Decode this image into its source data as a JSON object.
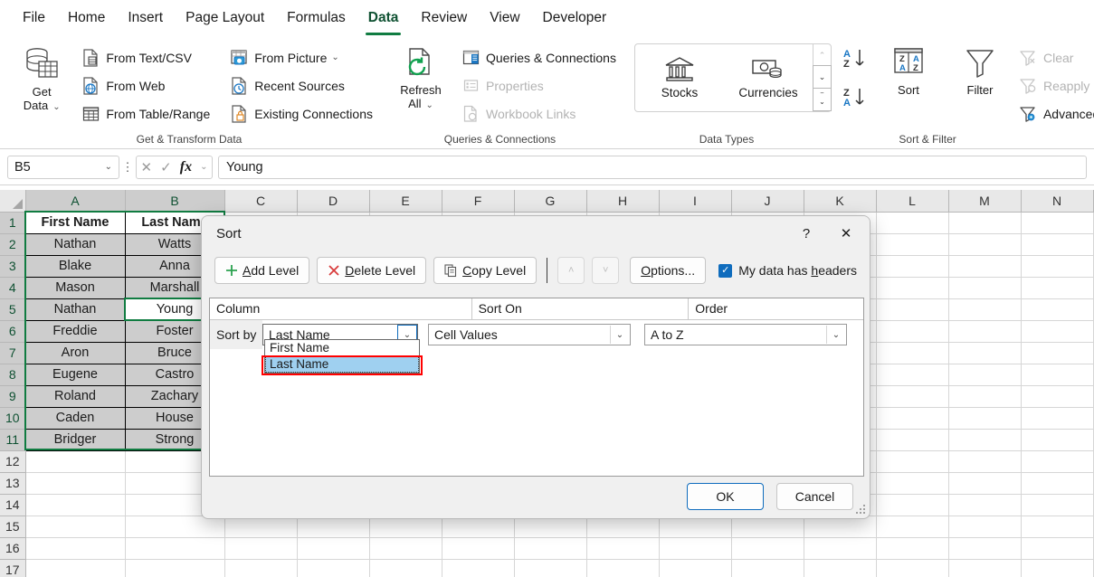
{
  "ribbon": {
    "tabs": [
      {
        "label": "File",
        "active": false
      },
      {
        "label": "Home",
        "active": false
      },
      {
        "label": "Insert",
        "active": false
      },
      {
        "label": "Page Layout",
        "active": false
      },
      {
        "label": "Formulas",
        "active": false
      },
      {
        "label": "Data",
        "active": true
      },
      {
        "label": "Review",
        "active": false
      },
      {
        "label": "View",
        "active": false
      },
      {
        "label": "Developer",
        "active": false
      }
    ],
    "groups": {
      "get_transform": {
        "label": "Get & Transform Data",
        "get_data": {
          "line1": "Get",
          "line2": "Data"
        },
        "items": [
          {
            "label": "From Text/CSV"
          },
          {
            "label": "From Web"
          },
          {
            "label": "From Table/Range"
          },
          {
            "label": "From Picture",
            "caret": true
          },
          {
            "label": "Recent Sources"
          },
          {
            "label": "Existing Connections"
          }
        ]
      },
      "queries": {
        "label": "Queries & Connections",
        "refresh": {
          "line1": "Refresh",
          "line2": "All"
        },
        "items": [
          {
            "label": "Queries & Connections",
            "disabled": false
          },
          {
            "label": "Properties",
            "disabled": true
          },
          {
            "label": "Workbook Links",
            "disabled": true
          }
        ]
      },
      "data_types": {
        "label": "Data Types",
        "items": [
          {
            "label": "Stocks"
          },
          {
            "label": "Currencies"
          }
        ]
      },
      "sort_filter": {
        "label": "Sort & Filter",
        "sort_label": "Sort",
        "filter_label": "Filter",
        "items": [
          {
            "label": "Clear",
            "disabled": true
          },
          {
            "label": "Reapply",
            "disabled": true
          },
          {
            "label": "Advanced",
            "disabled": false
          }
        ]
      }
    }
  },
  "formula_bar": {
    "name_box": "B5",
    "formula": "Young",
    "cancel_icon": "cancel-icon",
    "enter_icon": "enter-icon",
    "fx": "fx"
  },
  "grid": {
    "columns": [
      "A",
      "B",
      "C",
      "D",
      "E",
      "F",
      "G",
      "H",
      "I",
      "J",
      "K",
      "L",
      "M",
      "N"
    ],
    "rows": [
      1,
      2,
      3,
      4,
      5,
      6,
      7,
      8,
      9,
      10,
      11,
      12,
      13,
      14,
      15,
      16,
      17
    ],
    "selected_columns": [
      "A",
      "B"
    ],
    "selected_rows": [
      1,
      2,
      3,
      4,
      5,
      6,
      7,
      8,
      9,
      10,
      11
    ],
    "active_cell": "B5",
    "data": [
      {
        "row": 1,
        "a": "First Name",
        "b": "Last Name",
        "header": true
      },
      {
        "row": 2,
        "a": "Nathan",
        "b": "Watts"
      },
      {
        "row": 3,
        "a": "Blake",
        "b": "Anna"
      },
      {
        "row": 4,
        "a": "Mason",
        "b": "Marshall"
      },
      {
        "row": 5,
        "a": "Nathan",
        "b": "Young"
      },
      {
        "row": 6,
        "a": "Freddie",
        "b": "Foster"
      },
      {
        "row": 7,
        "a": "Aron",
        "b": "Bruce"
      },
      {
        "row": 8,
        "a": "Eugene",
        "b": "Castro"
      },
      {
        "row": 9,
        "a": "Roland",
        "b": "Zachary"
      },
      {
        "row": 10,
        "a": "Caden",
        "b": "House"
      },
      {
        "row": 11,
        "a": "Bridger",
        "b": "Strong"
      }
    ]
  },
  "sort_dialog": {
    "title": "Sort",
    "help_label": "?",
    "close_label": "✕",
    "toolbar": {
      "add_level": "Add Level",
      "delete_level": "Delete Level",
      "copy_level": "Copy Level",
      "move_up": "˄",
      "move_down": "˅",
      "options": "Options..."
    },
    "headers_checkbox": {
      "label": "My data has headers",
      "checked": true,
      "check_glyph": "✓"
    },
    "column_headers": {
      "column": "Column",
      "sort_on": "Sort On",
      "order": "Order"
    },
    "sort_by_label": "Sort by",
    "column_value": "Last Name",
    "sort_on_value": "Cell Values",
    "order_value": "A to Z",
    "dropdown": {
      "options": [
        "First Name",
        "Last Name"
      ],
      "selected": "Last Name"
    },
    "ok_label": "OK",
    "cancel_label": "Cancel"
  },
  "colors": {
    "excel_green": "#107c41",
    "accent_blue": "#0f6cbd",
    "annotation_red": "#ff0000",
    "highlight_blue": "#9fd0f0",
    "selection_gray": "#cdcdcd"
  }
}
